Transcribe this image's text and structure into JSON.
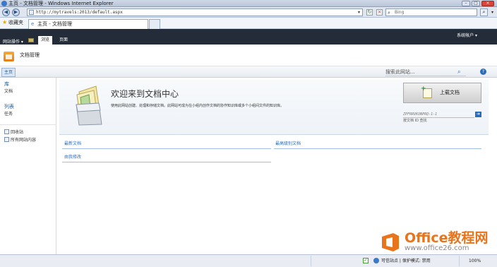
{
  "window": {
    "title": "主页 - 文档管理 - Windows Internet Explorer"
  },
  "address_bar": {
    "url": "http://mytravels:2013/default.aspx",
    "search_placeholder": "Bing"
  },
  "favorites_bar": {
    "favorites_label": "收藏夹",
    "tab_title": "主页 - 文档管理"
  },
  "sharepoint": {
    "site_actions": "网站操作 ▾",
    "ribbon_tabs": [
      {
        "label": "浏览"
      },
      {
        "label": "页面"
      }
    ],
    "system_account": "系统帐户 ▾",
    "site_title": "文档管理",
    "top_nav": {
      "home": "主页",
      "search_placeholder": "搜索此网站..."
    },
    "quick_launch": {
      "libraries_heading": "库",
      "documents_item": "文档",
      "lists_heading": "列表",
      "tasks_item": "任务",
      "recycle_bin": "回收站",
      "all_site_content": "所有网站内容"
    },
    "welcome": {
      "title": "欢迎来到文档中心",
      "description": "使用此网站创建、处理和存储文档。此网站可成为在小组内创作文档的协作知识库或多个小组间文件的知识库。",
      "upload_button": "上载文档",
      "document_id_input": "ZPFRRVKUNPRQ-1-1",
      "document_id_hint": "按文档 ID 查找"
    },
    "web_parts": {
      "latest_documents": "最新文档",
      "top_rated": "最高级别文档",
      "modified_by_me": "由我修改"
    }
  },
  "status_bar": {
    "zone": "可信站点 | 保护模式: 禁用",
    "zoom": "100%"
  },
  "watermark": {
    "brand": "Office教程网",
    "url": "www.office26.com"
  },
  "colors": {
    "ribbon_dark": "#232c38",
    "link_blue": "#2a6ebb",
    "watermark_orange": "#e8741c"
  }
}
